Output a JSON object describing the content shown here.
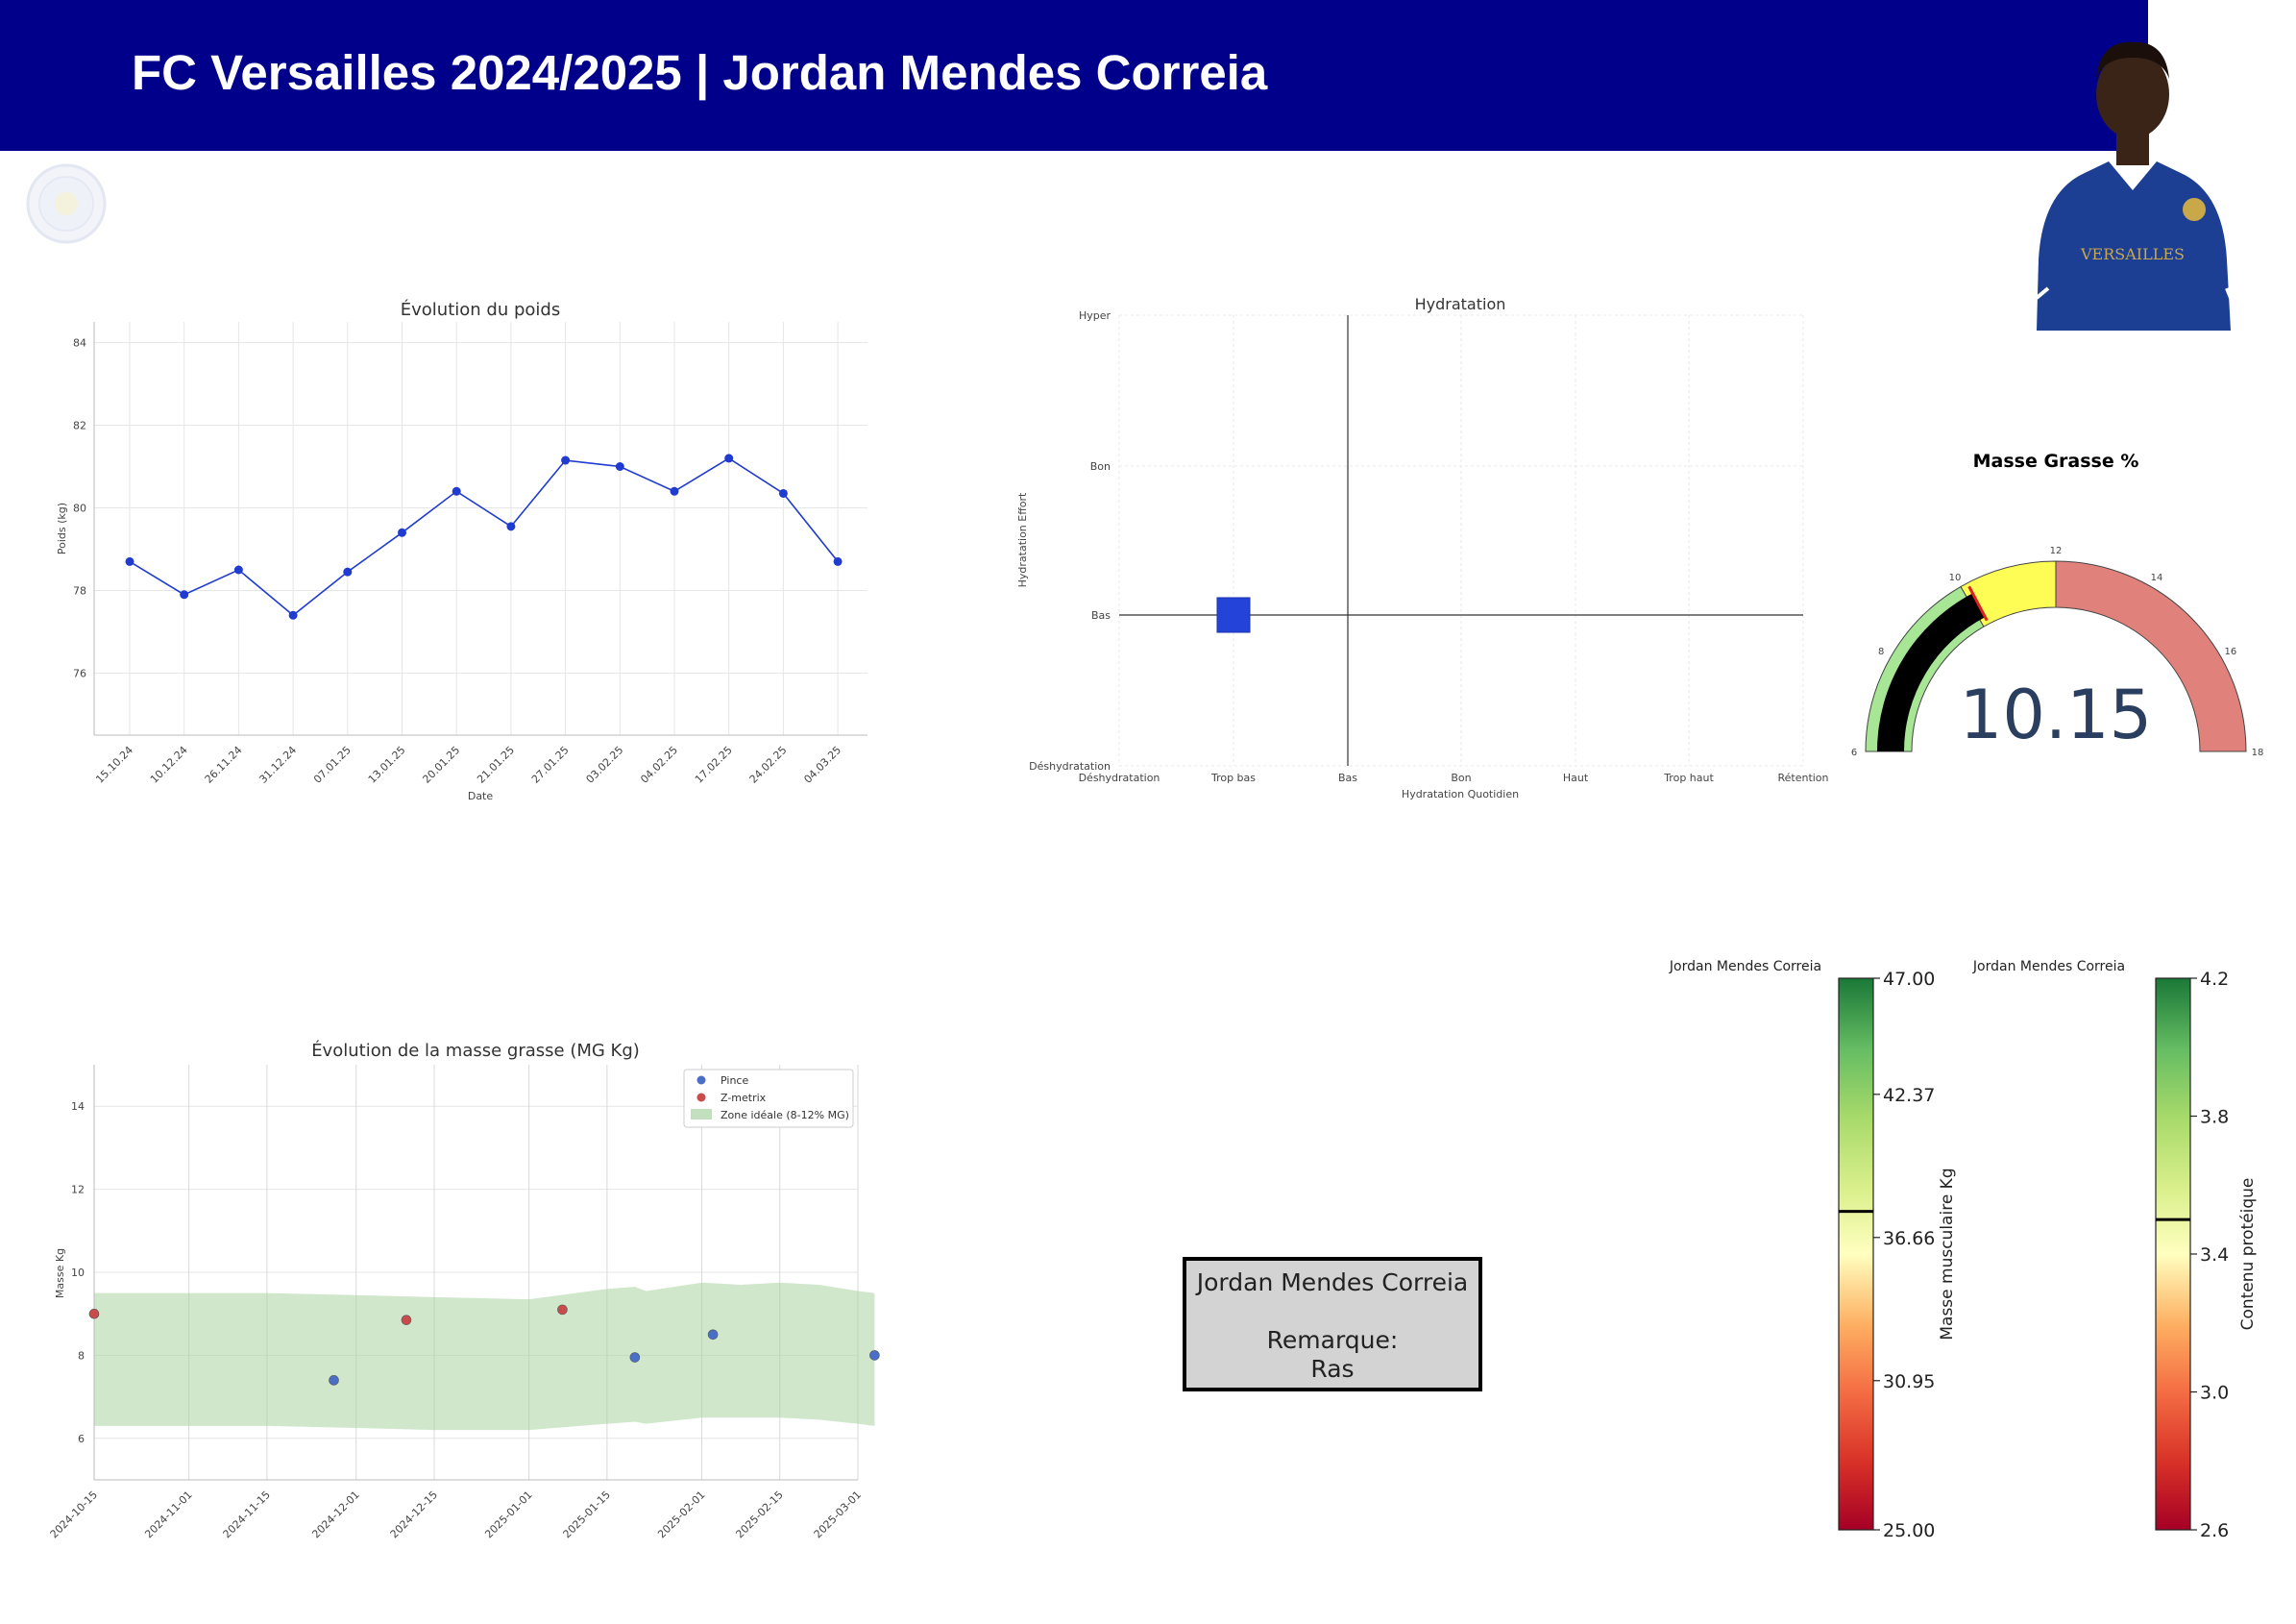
{
  "header": {
    "title": "FC Versailles 2024/2025 | Jordan Mendes Correia",
    "bg_color": "#00008b"
  },
  "colors": {
    "line": "#1f3bd0",
    "pince": "#4a6fc8",
    "zmetrix": "#c94c4c",
    "zone": "#a9d3a2"
  },
  "chart_data": [
    {
      "type": "line",
      "title": "Évolution du poids",
      "xlabel": "Date",
      "ylabel": "Poids (kg)",
      "ylim": [
        74.5,
        84.5
      ],
      "yticks": [
        "76",
        "78",
        "80",
        "82",
        "84"
      ],
      "categories": [
        "15.10.24",
        "10.12.24",
        "26.11.24",
        "31.12.24",
        "07.01.25",
        "13.01.25",
        "20.01.25",
        "21.01.25",
        "27.01.25",
        "03.02.25",
        "04.02.25",
        "17.02.25",
        "24.02.25",
        "04.03.25"
      ],
      "values": [
        78.7,
        77.9,
        78.5,
        77.4,
        78.45,
        79.4,
        80.4,
        79.55,
        81.15,
        81.0,
        80.4,
        81.2,
        80.35,
        78.7
      ],
      "grid": true
    },
    {
      "type": "scatter",
      "title": "Hydratation",
      "xlabel": "Hydratation Quotidien",
      "ylabel": "Hydratation Effort",
      "xcategories": [
        "Déshydratation",
        "Trop bas",
        "Bas",
        "Bon",
        "Haut",
        "Trop haut",
        "Rétention"
      ],
      "ycategories": [
        "Déshydratation",
        "Bas",
        "Bon",
        "Hyper"
      ],
      "point": {
        "x": "Trop bas",
        "y": "Bas"
      },
      "marker_color": "#2444d8"
    },
    {
      "type": "gauge",
      "title": "Masse Grasse %",
      "value": 10.15,
      "value_text": "10.15",
      "range": [
        6,
        18
      ],
      "ticks": [
        "6",
        "8",
        "10",
        "12",
        "14",
        "16",
        "18"
      ],
      "bands": [
        {
          "from": 6,
          "to": 10,
          "color": "#a6e695"
        },
        {
          "from": 10,
          "to": 12,
          "color": "#fdfd55"
        },
        {
          "from": 12,
          "to": 18,
          "color": "#e0827b"
        }
      ]
    },
    {
      "type": "scatter",
      "title": "Évolution de la masse grasse (MG Kg)",
      "ylabel": "Masse Kg",
      "ylim": [
        5,
        15
      ],
      "yticks": [
        "6",
        "8",
        "10",
        "12",
        "14"
      ],
      "x_range": [
        "2024-10-15",
        "2025-03-01"
      ],
      "xticks": [
        "2024-10-15",
        "2024-11-01",
        "2024-11-15",
        "2024-12-01",
        "2024-12-15",
        "2025-01-01",
        "2025-01-15",
        "2025-02-01",
        "2025-02-15",
        "2025-03-01"
      ],
      "series": [
        {
          "name": "Pince",
          "points": [
            [
              "2024-11-27",
              7.4
            ],
            [
              "2025-01-20",
              7.95
            ],
            [
              "2025-02-03",
              8.5
            ],
            [
              "2025-03-04",
              8.0
            ]
          ]
        },
        {
          "name": "Z-metrix",
          "points": [
            [
              "2024-10-15",
              9.0
            ],
            [
              "2024-12-10",
              8.85
            ],
            [
              "2025-01-07",
              9.1
            ]
          ]
        }
      ],
      "zone": {
        "name": "Zone idéale (8-12% MG)",
        "points": [
          [
            "2024-10-15",
            6.3,
            9.5
          ],
          [
            "2024-11-15",
            6.3,
            9.5
          ],
          [
            "2024-12-01",
            6.25,
            9.45
          ],
          [
            "2024-12-15",
            6.2,
            9.4
          ],
          [
            "2025-01-01",
            6.2,
            9.35
          ],
          [
            "2025-01-15",
            6.35,
            9.6
          ],
          [
            "2025-01-20",
            6.4,
            9.65
          ],
          [
            "2025-01-22",
            6.35,
            9.55
          ],
          [
            "2025-02-01",
            6.5,
            9.75
          ],
          [
            "2025-02-08",
            6.5,
            9.7
          ],
          [
            "2025-02-15",
            6.5,
            9.75
          ],
          [
            "2025-02-22",
            6.45,
            9.7
          ],
          [
            "2025-03-01",
            6.35,
            9.55
          ],
          [
            "2025-03-04",
            6.3,
            9.5
          ]
        ]
      },
      "legend": "top-right"
    },
    {
      "type": "colorbar",
      "title": "Jordan Mendes Correia",
      "label": "Masse musculaire Kg",
      "range": [
        25.0,
        47.0
      ],
      "ticks": [
        "25.00",
        "30.95",
        "36.66",
        "42.37",
        "47.00"
      ],
      "value": 37.7
    },
    {
      "type": "colorbar",
      "title": "Jordan Mendes Correia",
      "label": "Contenu protéique",
      "range": [
        2.6,
        4.2
      ],
      "ticks": [
        "2.6",
        "3.0",
        "3.4",
        "3.8",
        "4.2"
      ],
      "value": 3.5
    }
  ],
  "remark": {
    "name": "Jordan Mendes Correia",
    "label": "Remarque:",
    "text": "Ras"
  }
}
